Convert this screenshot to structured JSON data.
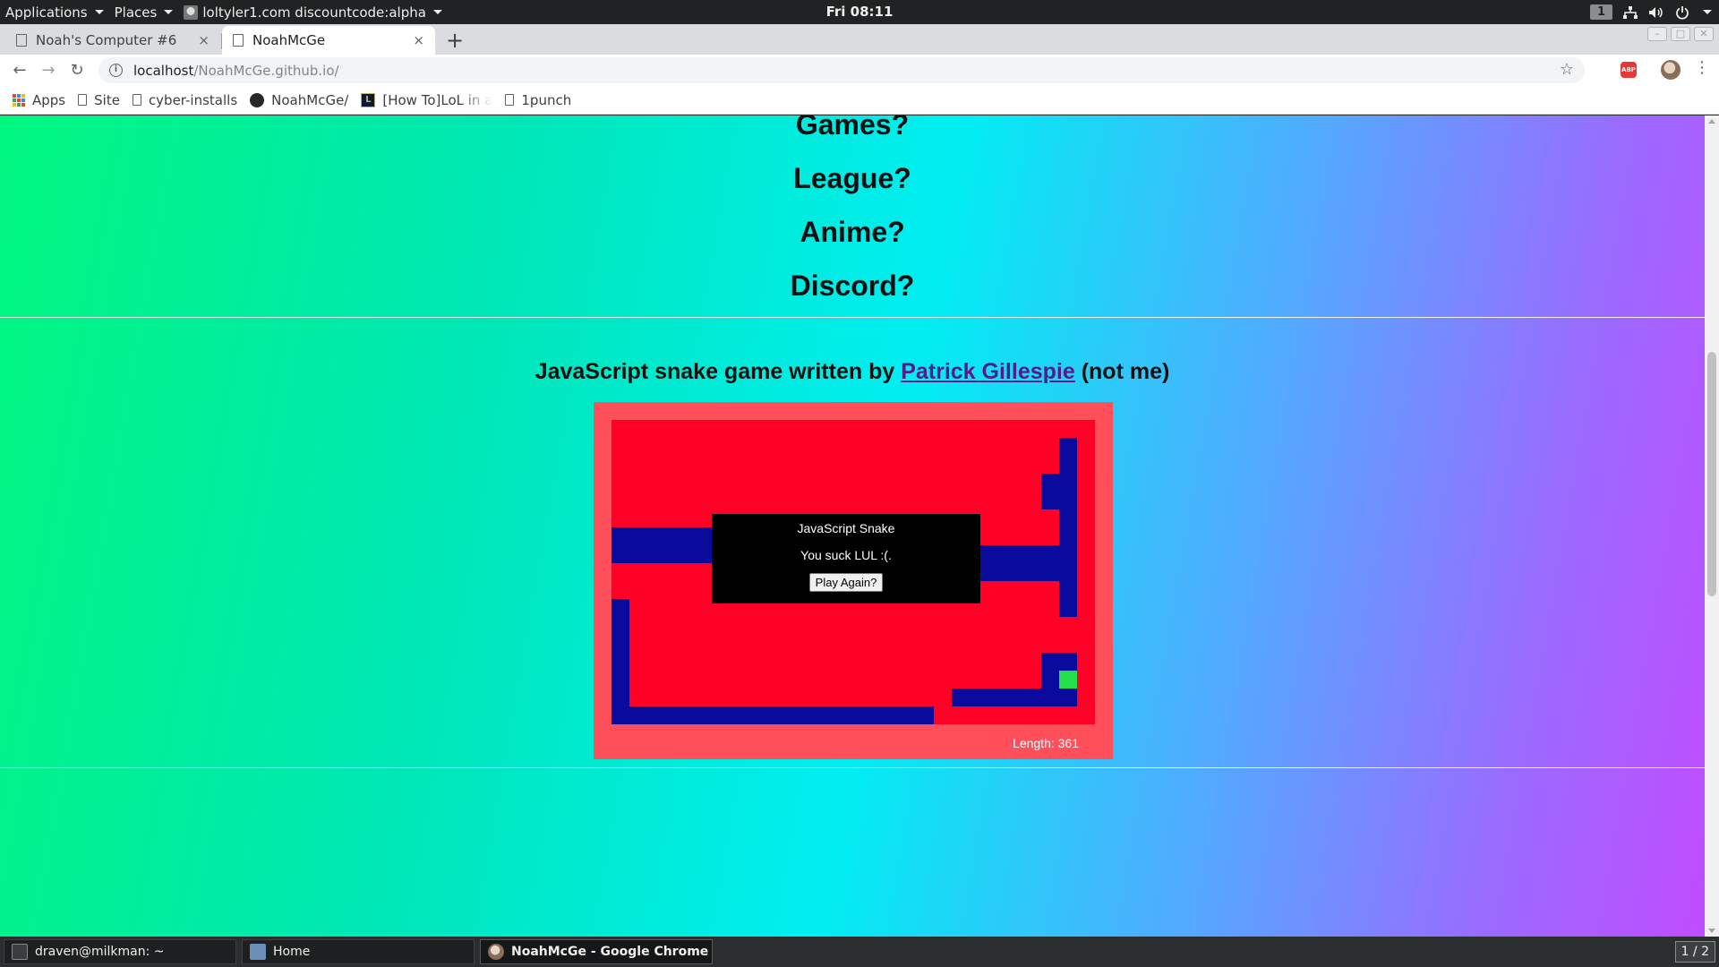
{
  "topbar": {
    "applications": "Applications",
    "places": "Places",
    "active_app": "loltyler1.com discountcode:alpha",
    "clock": "Fri 08:11",
    "workspace": "1"
  },
  "tabs": [
    {
      "label": "Noah's Computer #6",
      "close": "×"
    },
    {
      "label": "NoahMcGe",
      "close": "×"
    }
  ],
  "new_tab_label": "+",
  "address": {
    "host": "localhost",
    "path": "/NoahMcGe.github.io/",
    "info_glyph": "i"
  },
  "bookmarks": [
    {
      "label": "Apps",
      "icon": "apps-grid-icon"
    },
    {
      "label": "Site",
      "icon": "page-icon"
    },
    {
      "label": "cyber-installs",
      "icon": "page-icon"
    },
    {
      "label": "NoahMcGe/",
      "icon": "github-icon"
    },
    {
      "label": "[How To]LoL in a",
      "icon": "lol-icon"
    },
    {
      "label": "1punch",
      "icon": "page-icon"
    }
  ],
  "extension_abp": "ABP",
  "page": {
    "questions": [
      "Games?",
      "League?",
      "Anime?",
      "Discord?"
    ],
    "credit_prefix": "JavaScript snake game written by",
    "credit_link": "Patrick Gillespie",
    "credit_suffix": "(not me)"
  },
  "game": {
    "dialog_title": "JavaScript Snake",
    "dialog_message": "You suck LUL :(.",
    "play_again": "Play Again?",
    "length_label": "Length: 361",
    "colors": {
      "frame": "#ff4f5a",
      "board": "#ff0026",
      "snake": "#0a0a9c",
      "food": "#22e04a"
    }
  },
  "taskbar": {
    "items": [
      {
        "label": "draven@milkman: ~",
        "icon": "terminal-icon"
      },
      {
        "label": "Home",
        "icon": "files-icon"
      },
      {
        "label": "NoahMcGe - Google Chrome",
        "icon": "chrome-icon"
      }
    ],
    "pager": "1 / 2"
  }
}
